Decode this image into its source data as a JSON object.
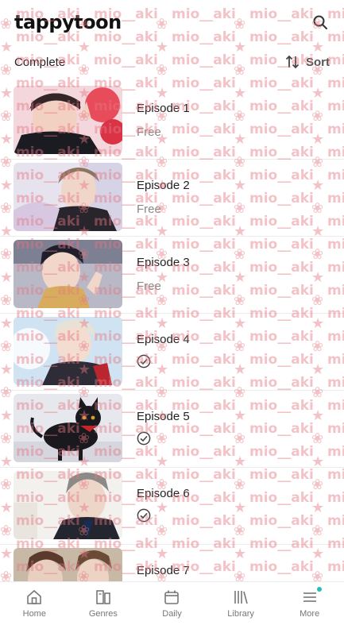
{
  "header": {
    "logo": "tappytoon",
    "search_icon": "search-icon"
  },
  "subheader": {
    "status": "Complete",
    "sort_label": "Sort",
    "sort_icon": "sort-arrows-icon"
  },
  "episodes": [
    {
      "title": "Episode 1",
      "status": "Free"
    },
    {
      "title": "Episode 2",
      "status": "Free"
    },
    {
      "title": "Episode 3",
      "status": "Free"
    },
    {
      "title": "Episode 4",
      "status": "read"
    },
    {
      "title": "Episode 5",
      "status": "read"
    },
    {
      "title": "Episode 6",
      "status": "read"
    },
    {
      "title": "Episode 7",
      "status": ""
    }
  ],
  "nav": {
    "items": [
      {
        "label": "Home",
        "icon": "home-icon"
      },
      {
        "label": "Genres",
        "icon": "genres-icon"
      },
      {
        "label": "Daily",
        "icon": "calendar-icon"
      },
      {
        "label": "Library",
        "icon": "library-icon"
      },
      {
        "label": "More",
        "icon": "menu-icon"
      }
    ],
    "notification_color": "#1fc0b5"
  },
  "watermark": {
    "text": "mio__aki",
    "color": "#e57882"
  },
  "colors": {
    "text_primary": "#222222",
    "text_secondary": "#888888",
    "divider": "#ececec"
  }
}
